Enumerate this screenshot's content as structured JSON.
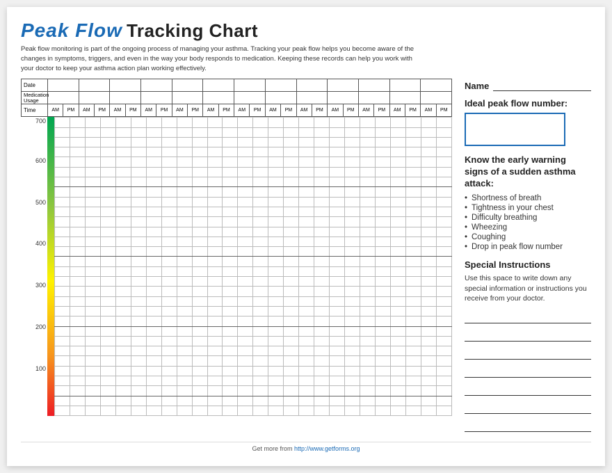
{
  "page": {
    "title_handwritten": "Peak Flow",
    "title_bold": "Tracking Chart",
    "subtitle": "Peak flow monitoring is part of the ongoing process of managing your asthma. Tracking your peak flow helps you become aware of the changes in symptoms, triggers, and even in the way your body responds to medication. Keeping these records can help you work with your doctor to keep your asthma action plan working effectively.",
    "name_label": "Name",
    "ideal_label": "Ideal peak flow number:",
    "warning_title": "Know the early warning signs of a sudden asthma attack:",
    "warning_items": [
      "Shortness of breath",
      "Tightness in your chest",
      "Difficulty breathing",
      "Wheezing",
      "Coughing",
      "Drop in peak flow number"
    ],
    "special_title": "Special Instructions",
    "special_desc": "Use this space to write down any special information or instructions you receive from your doctor.",
    "chart_labels": {
      "date": "Date",
      "medication": "Medication",
      "usage": "Usage",
      "time": "Time"
    },
    "y_axis": [
      700,
      600,
      500,
      400,
      300,
      200,
      100
    ],
    "num_cols": 13,
    "footer_text": "Get more from ",
    "footer_url": "http://www.getforms.org"
  }
}
